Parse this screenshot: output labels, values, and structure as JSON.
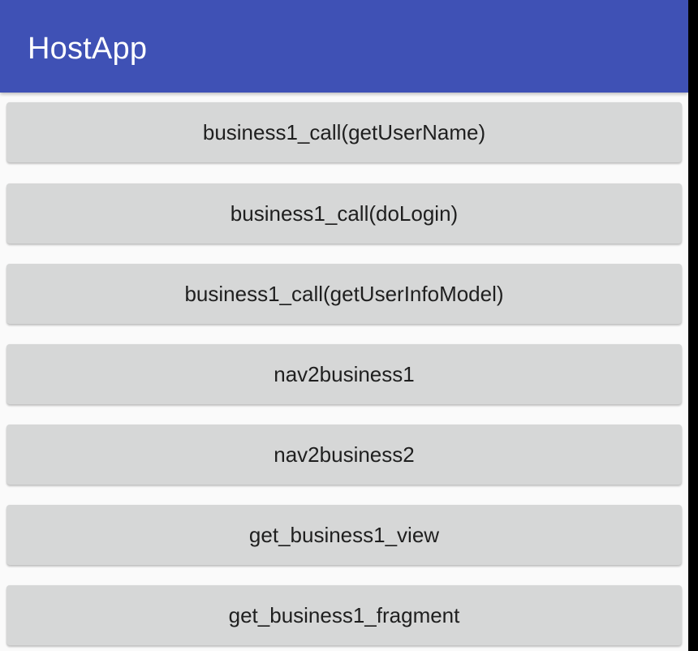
{
  "app_bar": {
    "title": "HostApp"
  },
  "buttons": [
    {
      "label": "business1_call(getUserName)"
    },
    {
      "label": "business1_call(doLogin)"
    },
    {
      "label": "business1_call(getUserInfoModel)"
    },
    {
      "label": "nav2business1"
    },
    {
      "label": "nav2business2"
    },
    {
      "label": "get_business1_view"
    },
    {
      "label": "get_business1_fragment"
    }
  ],
  "colors": {
    "app_bar": "#3f51b5",
    "background": "#fafafa",
    "button": "#d6d7d7",
    "button_text": "#1f1f1f"
  }
}
